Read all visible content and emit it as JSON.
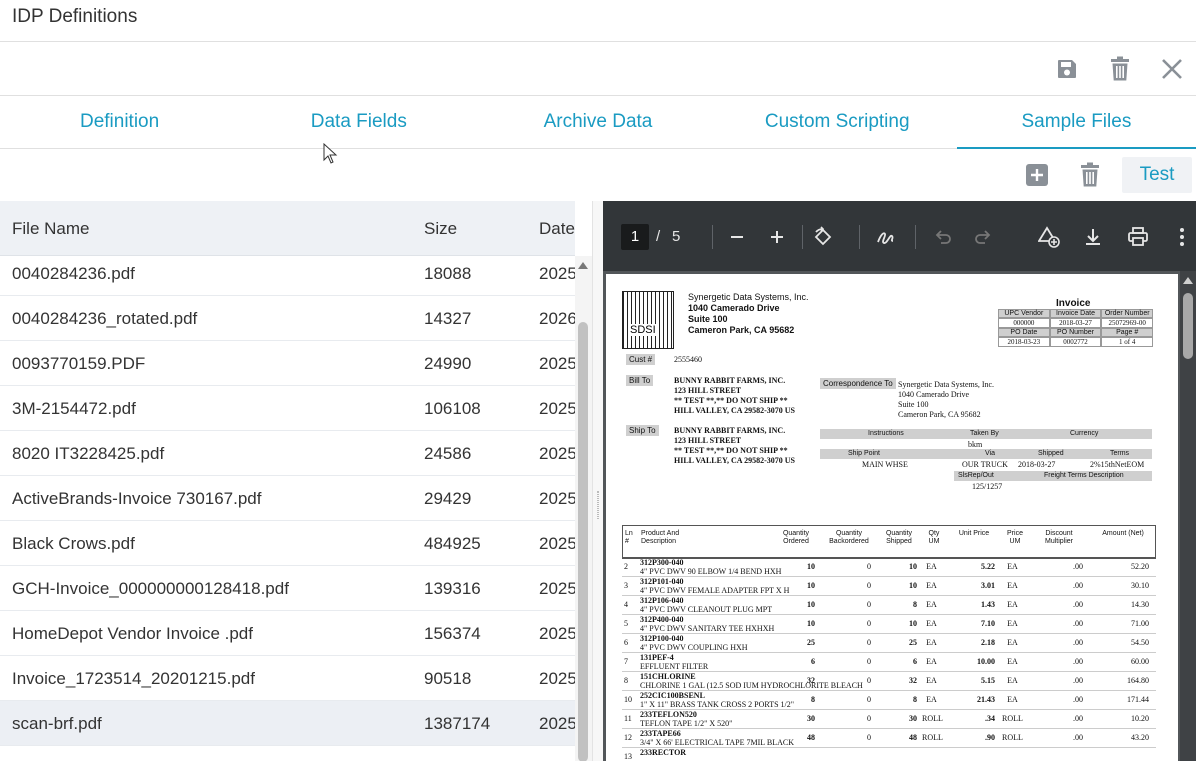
{
  "window": {
    "title": "IDP Definitions"
  },
  "toolbar": {
    "icons": [
      "save-icon",
      "trash-icon",
      "close-icon"
    ]
  },
  "tabs": [
    {
      "label": "Definition",
      "active": false
    },
    {
      "label": "Data Fields",
      "active": false
    },
    {
      "label": "Archive Data",
      "active": false
    },
    {
      "label": "Custom Scripting",
      "active": false
    },
    {
      "label": "Sample Files",
      "active": true
    }
  ],
  "actions": {
    "test_label": "Test"
  },
  "table": {
    "columns": [
      "File Name",
      "Size",
      "Date"
    ],
    "rows": [
      {
        "name": "0040284236.pdf",
        "size": "18088",
        "date": "2025"
      },
      {
        "name": "0040284236_rotated.pdf",
        "size": "14327",
        "date": "2026"
      },
      {
        "name": "0093770159.PDF",
        "size": "24990",
        "date": "2025"
      },
      {
        "name": "3M-2154472.pdf",
        "size": "106108",
        "date": "2025"
      },
      {
        "name": "8020 IT3228425.pdf",
        "size": "24586",
        "date": "2025"
      },
      {
        "name": "ActiveBrands-Invoice 730167.pdf",
        "size": "29429",
        "date": "2025"
      },
      {
        "name": "Black Crows.pdf",
        "size": "484925",
        "date": "2025"
      },
      {
        "name": "GCH-Invoice_000000000128418.pdf",
        "size": "139316",
        "date": "2025"
      },
      {
        "name": "HomeDepot Vendor Invoice .pdf",
        "size": "156374",
        "date": "2025"
      },
      {
        "name": "Invoice_1723514_20201215.pdf",
        "size": "90518",
        "date": "2025"
      },
      {
        "name": "scan-brf.pdf",
        "size": "1387174",
        "date": "2025",
        "selected": true
      }
    ]
  },
  "viewer": {
    "page_current": "1",
    "page_sep": "/",
    "page_total": "5"
  },
  "invoice": {
    "company": "Synergetic Data Systems, Inc.",
    "address1": "1040 Camerado Drive",
    "address2": "Suite 100",
    "address3": "Cameron Park, CA 95682",
    "logo_text": "SDSI",
    "title": "Invoice",
    "grid_head1": [
      "UPC Vendor",
      "Invoice Date",
      "Order Number"
    ],
    "grid_val1": [
      "000000",
      "2018-03-27",
      "25072969-00"
    ],
    "grid_head2": [
      "PO Date",
      "PO Number",
      "Page #"
    ],
    "grid_val2": [
      "2018-03-23",
      "0002772",
      "1 of 4"
    ],
    "cust_label": "Cust #",
    "cust_no": "2555460",
    "bill_label": "Bill To",
    "bill": [
      "BUNNY RABBIT FARMS, INC.",
      "123 HILL STREET",
      "** TEST **,** DO NOT SHIP **",
      "HILL VALLEY, CA 29582-3070 US"
    ],
    "corr_label": "Correspondence To",
    "corr": [
      "Synergetic Data Systems, Inc.",
      "1040 Camerado Drive",
      "Suite 100",
      "Cameron Park, CA 95682"
    ],
    "ship_label": "Ship To",
    "ship": [
      "BUNNY RABBIT FARMS, INC.",
      "123 HILL STREET",
      "** TEST **,** DO NOT SHIP **",
      "HILL VALLEY, CA 29582-3070 US"
    ],
    "instr": [
      "Instructions",
      "Taken By",
      "Currency"
    ],
    "taken_by": "bkm",
    "ship_hdr": [
      "Ship Point",
      "Via",
      "Shipped",
      "Terms"
    ],
    "ship_vals": [
      "MAIN WHSE",
      "OUR TRUCK",
      "2018-03-27",
      "2%15thNetEOM"
    ],
    "sls_hdr": [
      "SlsRep/Out",
      "Freight Terms Description"
    ],
    "sls_val": "125/1257",
    "line_head": [
      "Ln #",
      "Product And Description",
      "Quantity Ordered",
      "Quantity Backordered",
      "Quantity Shipped",
      "Qty UM",
      "Unit Price",
      "Price UM",
      "Discount Multiplier",
      "Amount (Net)"
    ],
    "lines": [
      {
        "ln": "2",
        "code": "312P300-040",
        "desc": "4\" PVC DWV 90 ELBOW 1/4 BEND HXH",
        "ord": "10",
        "bo": "0",
        "sh": "10",
        "um": "EA",
        "price": "5.22",
        "pum": "EA",
        "disc": ".00",
        "amt": "52.20"
      },
      {
        "ln": "3",
        "code": "312P101-040",
        "desc": "4\" PVC DWV FEMALE ADAPTER FPT X H",
        "ord": "10",
        "bo": "0",
        "sh": "10",
        "um": "EA",
        "price": "3.01",
        "pum": "EA",
        "disc": ".00",
        "amt": "30.10"
      },
      {
        "ln": "4",
        "code": "312P106-040",
        "desc": "4\" PVC DWV CLEANOUT PLUG MPT",
        "ord": "10",
        "bo": "0",
        "sh": "8",
        "um": "EA",
        "price": "1.43",
        "pum": "EA",
        "disc": ".00",
        "amt": "14.30"
      },
      {
        "ln": "5",
        "code": "312P400-040",
        "desc": "4\" PVC DWV SANITARY TEE HXHXH",
        "ord": "10",
        "bo": "0",
        "sh": "10",
        "um": "EA",
        "price": "7.10",
        "pum": "EA",
        "disc": ".00",
        "amt": "71.00"
      },
      {
        "ln": "6",
        "code": "312P100-040",
        "desc": "4\" PVC DWV COUPLING HXH",
        "ord": "25",
        "bo": "0",
        "sh": "25",
        "um": "EA",
        "price": "2.18",
        "pum": "EA",
        "disc": ".00",
        "amt": "54.50"
      },
      {
        "ln": "7",
        "code": "131PEF-4",
        "desc": "EFFLUENT FILTER",
        "ord": "6",
        "bo": "0",
        "sh": "6",
        "um": "EA",
        "price": "10.00",
        "pum": "EA",
        "disc": ".00",
        "amt": "60.00"
      },
      {
        "ln": "8",
        "code": "151CHLORINE",
        "desc": "CHLORINE 1 GAL (12.5 SOD IUM HYDROCHLORITE BLEACH",
        "ord": "32",
        "bo": "0",
        "sh": "32",
        "um": "EA",
        "price": "5.15",
        "pum": "EA",
        "disc": ".00",
        "amt": "164.80"
      },
      {
        "ln": "10",
        "code": "252CIC100BSENL",
        "desc": "1\" X 11\" BRASS TANK CROSS 2 PORTS 1/2\"",
        "ord": "8",
        "bo": "0",
        "sh": "8",
        "um": "EA",
        "price": "21.43",
        "pum": "EA",
        "disc": ".00",
        "amt": "171.44"
      },
      {
        "ln": "11",
        "code": "233TEFLON520",
        "desc": "TEFLON TAPE 1/2\" X 520\"",
        "ord": "30",
        "bo": "0",
        "sh": "30",
        "um": "ROLL",
        "price": ".34",
        "pum": "ROLL",
        "disc": ".00",
        "amt": "10.20"
      },
      {
        "ln": "12",
        "code": "233TAPE66",
        "desc": "3/4\" X 66' ELECTRICAL TAPE 7MIL BLACK",
        "ord": "48",
        "bo": "0",
        "sh": "48",
        "um": "ROLL",
        "price": ".90",
        "pum": "ROLL",
        "disc": ".00",
        "amt": "43.20"
      },
      {
        "ln": "13",
        "code": "233RECTOR",
        "desc": "",
        "ord": "",
        "bo": "",
        "sh": "",
        "um": "",
        "price": "",
        "pum": "",
        "disc": "",
        "amt": ""
      }
    ]
  },
  "colors": {
    "accent": "#1a9bc2",
    "icon_grey": "#8a9097",
    "viewer_bg": "#525659",
    "viewer_bar": "#323639"
  }
}
